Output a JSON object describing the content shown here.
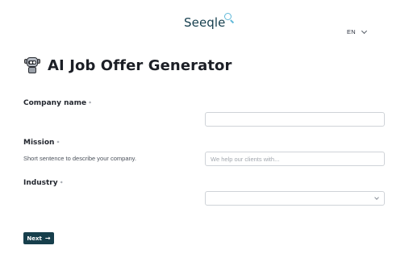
{
  "brand": {
    "name": "Seeqle",
    "accent": "#5fb8d8",
    "dark": "#173f4c"
  },
  "language": {
    "selected": "EN"
  },
  "page": {
    "title": "AI Job Offer Generator",
    "title_icon": "robot-icon"
  },
  "form": {
    "required_mark": "*",
    "company_name": {
      "label": "Company name",
      "value": ""
    },
    "mission": {
      "label": "Mission",
      "help": "Short sentence to describe your company.",
      "placeholder": "We help our clients with...",
      "value": ""
    },
    "industry": {
      "label": "Industry",
      "selected": ""
    },
    "next_label": "Next",
    "next_icon": "arrow-right-icon"
  }
}
